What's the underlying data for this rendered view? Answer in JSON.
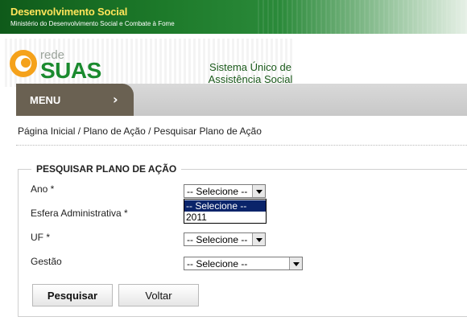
{
  "top_banner": {
    "title": "Desenvolvimento Social",
    "subtitle": "Ministério do Desenvolvimento Social e Combate à Fome"
  },
  "logo": {
    "rede": "rede",
    "suas": "SUAS"
  },
  "system_title": {
    "line1": "Sistema Único de",
    "line2": "Assistência Social"
  },
  "menu": {
    "label": "MENU",
    "arrow": "›"
  },
  "breadcrumb": "Página Inicial / Plano de Ação / Pesquisar Plano de Ação",
  "form": {
    "legend": "PESQUISAR PLANO DE AÇÃO",
    "ano": {
      "label": "Ano *",
      "value": "-- Selecione --",
      "options": [
        "-- Selecione --",
        "2011"
      ]
    },
    "esfera": {
      "label": "Esfera Administrativa *"
    },
    "uf": {
      "label": "UF *",
      "value": "-- Selecione --"
    },
    "gestao": {
      "label": "Gestão",
      "value": "-- Selecione --"
    }
  },
  "buttons": {
    "search": "Pesquisar",
    "back": "Voltar"
  },
  "colors": {
    "banner_green": "#1d7a2a",
    "menu_brown": "#6a6152",
    "suas_green": "#1a8a2e",
    "logo_orange": "#f5a21b",
    "selected_option": "#0a246a"
  }
}
